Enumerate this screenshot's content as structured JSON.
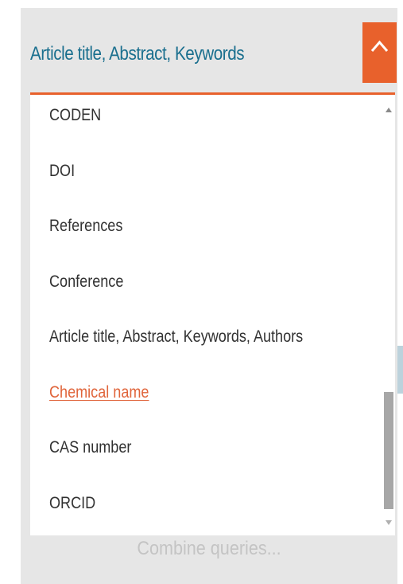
{
  "search_field": {
    "selected_label": "Article title, Abstract, Keywords",
    "toggle_icon": "chevron-up-icon"
  },
  "dropdown": {
    "options": [
      {
        "label": "CODEN"
      },
      {
        "label": "DOI"
      },
      {
        "label": "References"
      },
      {
        "label": "Conference"
      },
      {
        "label": "Article title, Abstract, Keywords, Authors"
      },
      {
        "label": "Chemical name"
      },
      {
        "label": "CAS number"
      },
      {
        "label": "ORCID"
      }
    ],
    "active_option": "Chemical name"
  },
  "combine_link": "Combine queries...",
  "colors": {
    "accent": "#e8612c",
    "label_blue": "#1a6f8e",
    "active_link": "#e0643a",
    "panel_bg": "#e6e6e6"
  }
}
